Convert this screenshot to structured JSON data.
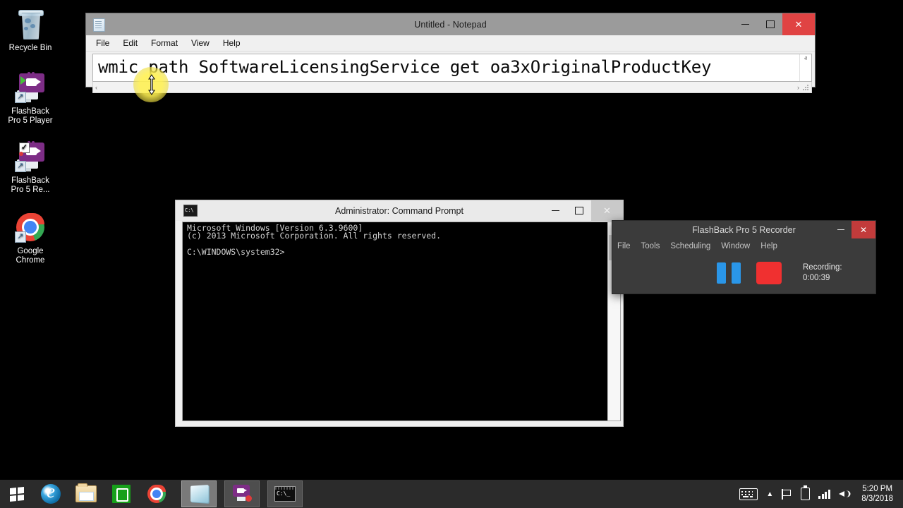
{
  "desktop": {
    "icons": [
      {
        "name": "recycle-bin",
        "label": "Recycle Bin"
      },
      {
        "name": "flashback-player",
        "label": "FlashBack\nPro 5 Player",
        "line1": "FlashBack",
        "line2": "Pro 5 Player"
      },
      {
        "name": "flashback-recorder",
        "label": "FlashBack\nPro 5 Re...",
        "line1": "FlashBack",
        "line2": "Pro 5 Re..."
      },
      {
        "name": "google-chrome",
        "label": "Google\nChrome",
        "line1": "Google",
        "line2": "Chrome"
      }
    ]
  },
  "notepad": {
    "title": "Untitled - Notepad",
    "icon": "notepad-icon",
    "menu": [
      "File",
      "Edit",
      "Format",
      "View",
      "Help"
    ],
    "content": "wmic path SoftwareLicensingService get oa3xOriginalProductKey",
    "scroll_up": "ⱏ",
    "scroll_down": "ⱟ",
    "hscroll_left": "‹",
    "hscroll_right": "›",
    "buttons": {
      "minimize": "–",
      "maximize": "❐",
      "close": "✕"
    },
    "close_color": "#e04343",
    "titlebar_color": "#9b9b9b"
  },
  "cmd": {
    "title": "Administrator: Command Prompt",
    "icon_text": "C:\\",
    "console_lines": [
      "Microsoft Windows [Version 6.3.9600]",
      "(c) 2013 Microsoft Corporation. All rights reserved.",
      "",
      "C:\\WINDOWS\\system32>"
    ],
    "buttons": {
      "minimize": "–",
      "maximize": "❐",
      "close": "✕"
    },
    "scroll_up": "ⱏ",
    "scroll_down": "ⱟ",
    "titlebar_color": "#eaeaea",
    "console_bg": "#000000",
    "console_fg": "#d6d6d6"
  },
  "flashback": {
    "title": "FlashBack Pro 5 Recorder",
    "menu": [
      "File",
      "Tools",
      "Scheduling",
      "Window",
      "Help"
    ],
    "buttons": {
      "minimize": "–",
      "close": "✕"
    },
    "pause_label": "pause-button",
    "stop_label": "stop-button",
    "status_label": "Recording:",
    "status_time": "0:00:39",
    "pause_color": "#2a96e8",
    "stop_color": "#f03030",
    "window_bg": "#3b3b3b"
  },
  "taskbar": {
    "start": "start-button",
    "items": [
      {
        "name": "taskbar-internet-explorer",
        "glyph": "ie-icon",
        "state": "pinned"
      },
      {
        "name": "taskbar-file-explorer",
        "glyph": "folder-icon",
        "state": "pinned"
      },
      {
        "name": "taskbar-store",
        "glyph": "store-icon",
        "state": "pinned"
      },
      {
        "name": "taskbar-chrome",
        "glyph": "chrome-icon",
        "state": "pinned"
      },
      {
        "name": "taskbar-notepad",
        "glyph": "notepad-icon",
        "state": "active"
      },
      {
        "name": "taskbar-flashback-recorder",
        "glyph": "flashback-recorder-icon",
        "state": "open"
      },
      {
        "name": "taskbar-command-prompt",
        "glyph": "command-prompt-icon",
        "state": "open"
      }
    ],
    "tray": {
      "keyboard": "keyboard-icon",
      "show_hidden": "▲",
      "action_center": "flag-icon",
      "battery": "battery-icon",
      "network": "signal-icon",
      "volume": "volume-icon",
      "time": "5:20 PM",
      "date": "8/3/2018"
    },
    "background": "#2b2b2b"
  }
}
